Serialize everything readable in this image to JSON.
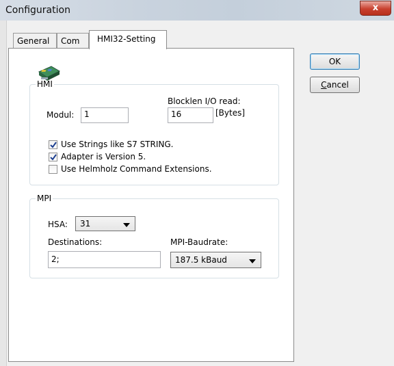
{
  "window": {
    "title": "Configuration",
    "close_symbol": "x"
  },
  "tabs": [
    {
      "label": "General"
    },
    {
      "label": "Com"
    },
    {
      "label": "HMI32-Setting"
    }
  ],
  "buttons": {
    "ok": "OK",
    "cancel_first": "C",
    "cancel_rest": "ancel"
  },
  "hmi": {
    "legend": "HMI",
    "modul_label": "Modul:",
    "modul_value": "1",
    "blocklen_label": "Blocklen I/O read:",
    "blocklen_value": "16",
    "blocklen_unit": "[Bytes]",
    "checkboxes": [
      {
        "label": "Use Strings like S7 STRING.",
        "checked": true
      },
      {
        "label": "Adapter is Version 5.",
        "checked": true
      },
      {
        "label": "Use Helmholz Command Extensions.",
        "checked": false
      }
    ]
  },
  "mpi": {
    "legend": "MPI",
    "hsa_label": "HSA:",
    "hsa_value": "31",
    "destinations_label": "Destinations:",
    "destinations_value": "2;",
    "baudrate_label": "MPI-Baudrate:",
    "baudrate_value": "187.5 kBaud"
  }
}
